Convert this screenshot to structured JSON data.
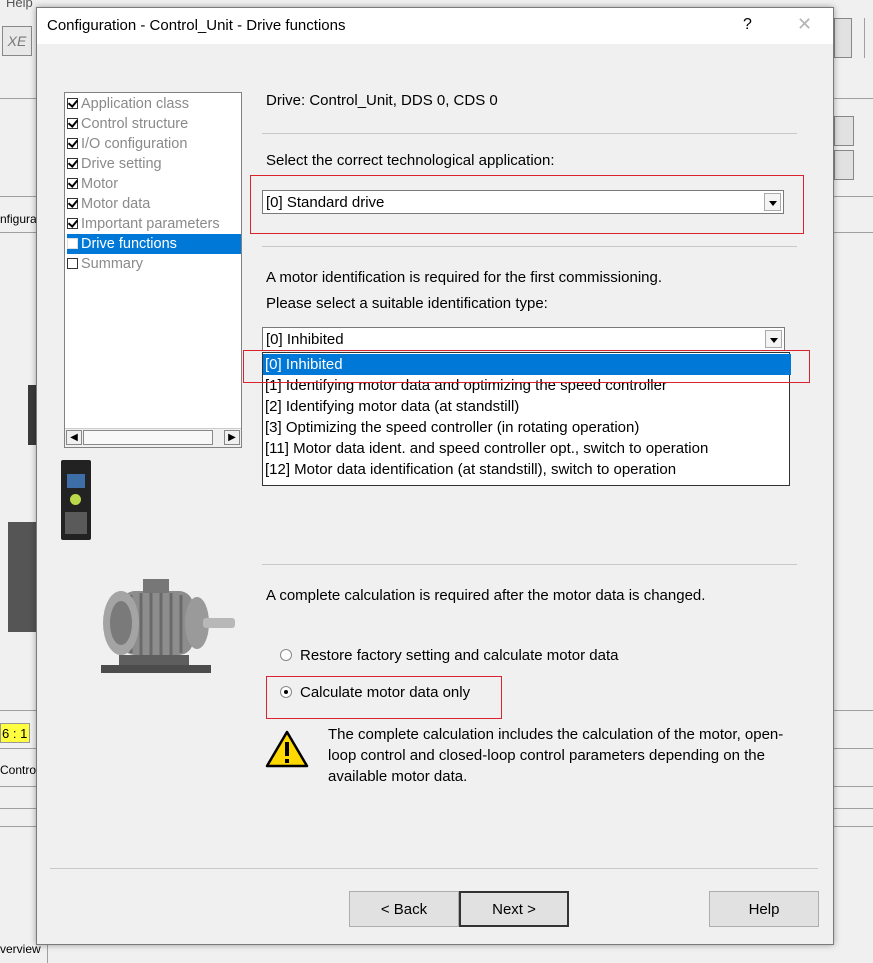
{
  "background": {
    "menu_help": "Help",
    "tool_glyph": "XE",
    "left_label": "nfiguration",
    "ratio": "6 : 1",
    "control_label": "Control_",
    "overview_label": "verview"
  },
  "dialog": {
    "title": "Configuration - Control_Unit - Drive functions",
    "help_glyph": "?",
    "close_glyph": "✕"
  },
  "tree": {
    "items": [
      {
        "label": "Application class",
        "checked": true
      },
      {
        "label": "Control structure",
        "checked": true
      },
      {
        "label": "I/O configuration",
        "checked": true
      },
      {
        "label": "Drive setting",
        "checked": true
      },
      {
        "label": "Motor",
        "checked": true
      },
      {
        "label": "Motor data",
        "checked": true
      },
      {
        "label": "Important parameters",
        "checked": true
      },
      {
        "label": "Drive functions",
        "checked": false,
        "selected": true
      },
      {
        "label": "Summary",
        "checked": false
      }
    ]
  },
  "content": {
    "drive_info": "Drive: Control_Unit, DDS 0, CDS 0",
    "tech_app_label": "Select the correct technological application:",
    "tech_app_value": "[0] Standard drive",
    "ident_label_1": "A motor identification is required for the first commissioning.",
    "ident_label_2": "Please select a suitable identification type:",
    "ident_value": "[0] Inhibited",
    "ident_options": [
      "[0] Inhibited",
      "[1] Identifying motor data and optimizing the speed controller",
      "[2] Identifying motor data (at standstill)",
      "[3] Optimizing the speed controller (in rotating operation)",
      "[11] Motor data ident. and speed controller opt., switch to operation",
      "[12] Motor data identification (at standstill), switch to operation"
    ],
    "calc_label": "A complete calculation is required after the motor data is changed.",
    "radio_restore": "Restore factory setting and calculate motor data",
    "radio_calc_only": "Calculate motor data only",
    "radio_selected": "calc_only",
    "warning_text": "The complete calculation includes the calculation of the motor, open-loop control and closed-loop control parameters depending on the available motor data."
  },
  "buttons": {
    "back": "< Back",
    "next": "Next >",
    "help": "Help"
  },
  "colors": {
    "selection": "#0078d7",
    "highlight_box": "#d9232e",
    "warning_yellow": "#ffd800"
  }
}
